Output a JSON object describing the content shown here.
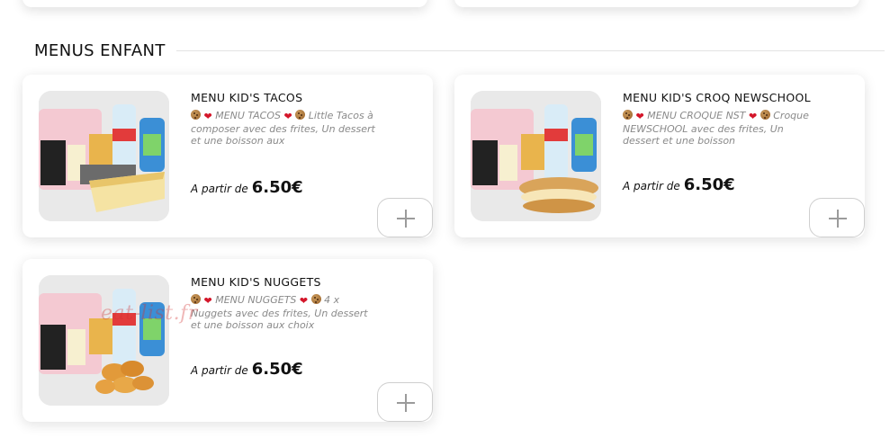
{
  "section": {
    "title": "MENUS ENFANT"
  },
  "price_label": "A partir de",
  "items": [
    {
      "name": "MENU KID'S TACOS",
      "desc_head": "MENU TACOS",
      "desc_tail": "Little",
      "desc_body": "Tacos à composer avec des frites, Un dessert et une boisson aux",
      "price": "6.50€"
    },
    {
      "name": "MENU KID'S CROQ NEWSCHOOL",
      "desc_head": "MENU CROQUE NST",
      "desc_tail": "",
      "desc_body": "Croque NEWSCHOOL avec des frites, Un dessert et une boisson",
      "price": "6.50€"
    },
    {
      "name": "MENU KID'S NUGGETS",
      "desc_head": "MENU NUGGETS",
      "desc_tail": "4 x",
      "desc_body": "Nuggets avec des frites, Un dessert et une boisson aux choix",
      "price": "6.50€"
    }
  ],
  "watermark": "eat-list.fr",
  "colors": {
    "heart": "#d4162a",
    "text": "#111111",
    "muted": "#8a8a8a",
    "watermark": "#d23232"
  },
  "icons": {
    "add": "plus-icon",
    "heart": "heart-emoji-icon",
    "cookie": "cookie-emoji-icon"
  }
}
